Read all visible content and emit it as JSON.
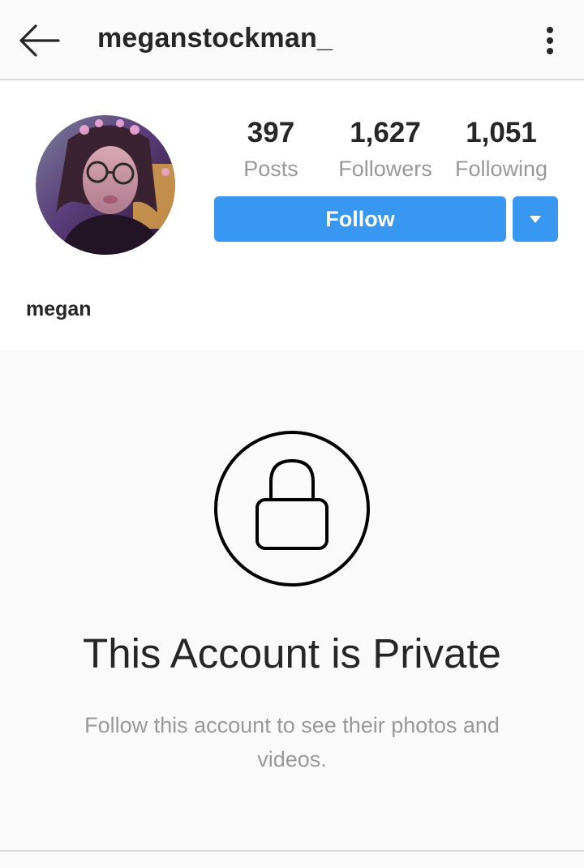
{
  "header": {
    "username": "meganstockman_",
    "back_icon": "arrow-left-icon",
    "more_icon": "more-vertical-icon"
  },
  "profile": {
    "stats": [
      {
        "value": "397",
        "label": "Posts"
      },
      {
        "value": "1,627",
        "label": "Followers"
      },
      {
        "value": "1,051",
        "label": "Following"
      }
    ],
    "follow_label": "Follow",
    "dropdown_icon": "caret-down-icon",
    "display_name": "megan",
    "accent_color": "#3897f0"
  },
  "private": {
    "icon": "lock-icon",
    "title": "This Account is Private",
    "subtitle": "Follow this account to see their photos and videos."
  }
}
